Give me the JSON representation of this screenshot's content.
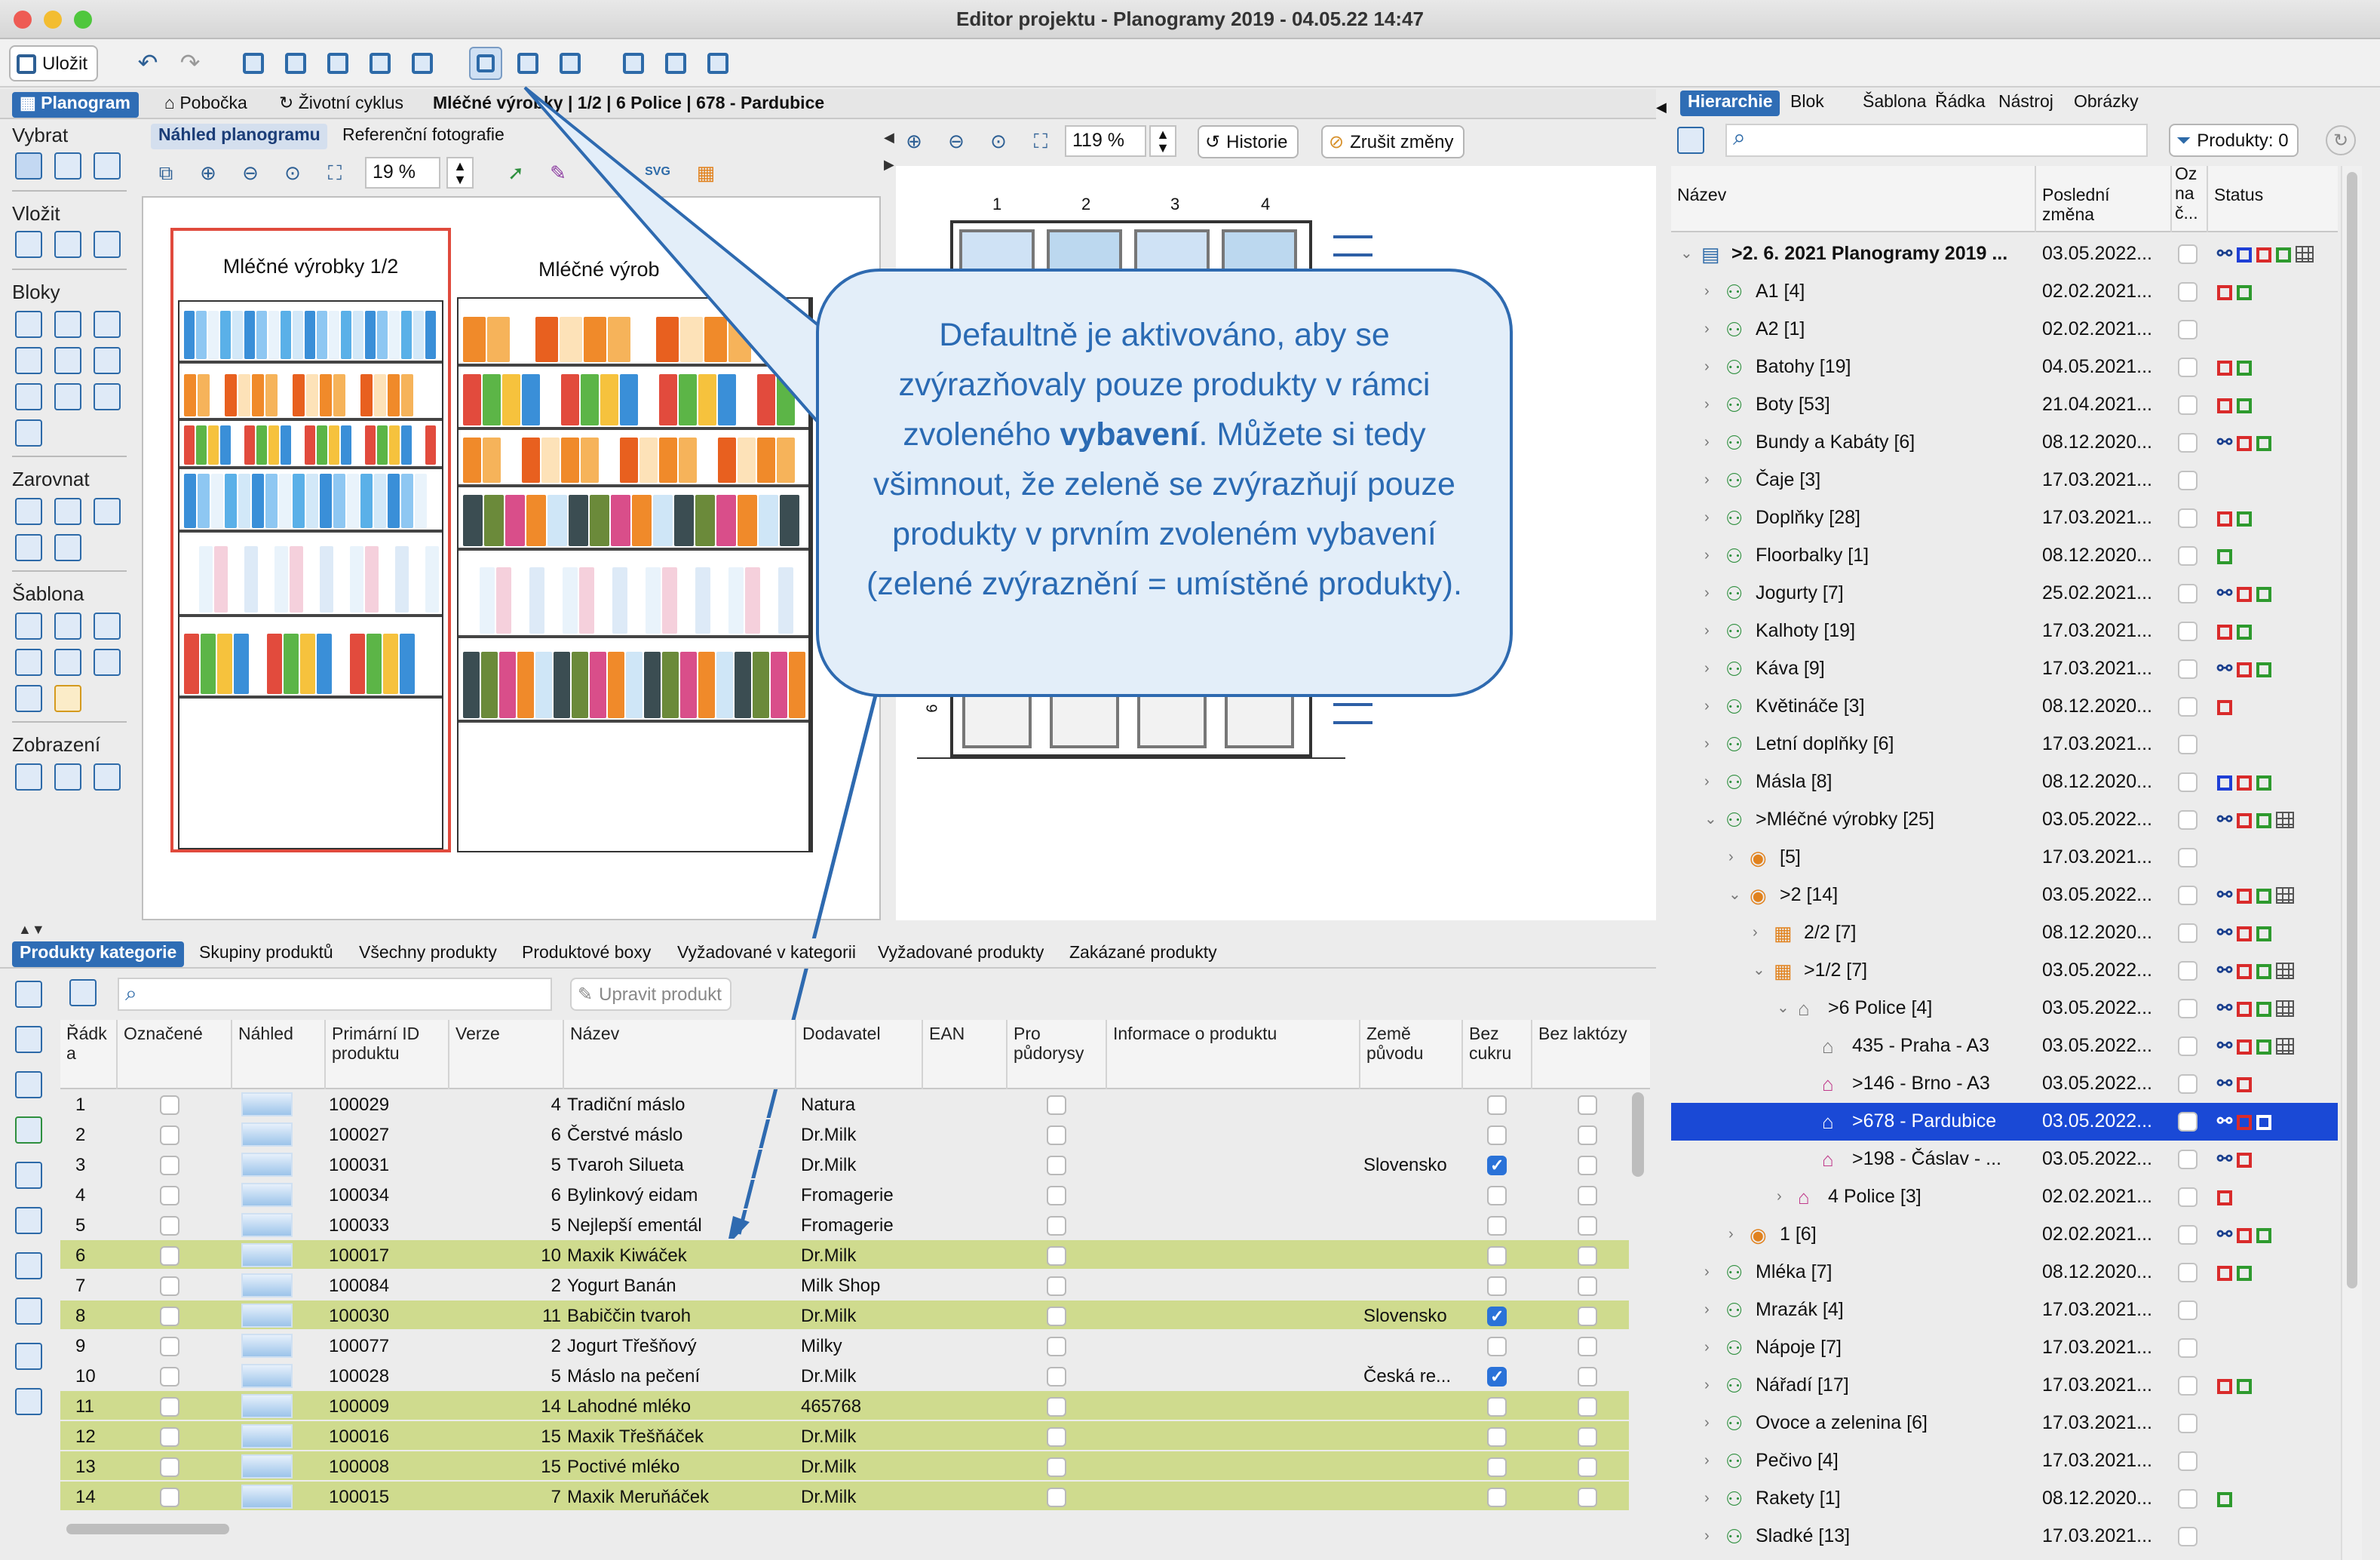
{
  "window": {
    "title": "Editor projektu - Planogramy 2019 - 04.05.22 14:47"
  },
  "toolbar": {
    "save": "Uložit"
  },
  "left_tabs": {
    "items": [
      "Planogram",
      "Pobočka",
      "Životní cyklus"
    ],
    "breadcrumb": "Mléčné výrobky | 1/2 | 6 Police | 678 - Pardubice"
  },
  "sidebar": {
    "sections": [
      "Vybrat",
      "Vložit",
      "Bloky",
      "Zarovnat",
      "Šablona",
      "Zobrazení"
    ]
  },
  "preview_tabs": [
    "Náhled planogramu",
    "Referenční fotografie"
  ],
  "preview": {
    "zoom": "19 %",
    "svg_label": "SVG",
    "title1": "Mléčné výrobky 1/2",
    "title2": "Mléčné výrob"
  },
  "detail": {
    "zoom": "119 %",
    "history": "Historie",
    "cancel": "Zrušit změny",
    "columns": [
      "1",
      "2",
      "3",
      "4"
    ],
    "shelf_num": "6"
  },
  "callout": {
    "part1": "Defaultně je aktivováno, aby se zvýrazňovaly pouze produkty v rámci zvoleného ",
    "bold": "vybavení",
    "part2": ". Můžete si tedy všimnout, že zeleně se zvýrazňují pouze produkty v prvním zvoleném vybavení (zelené zvýraznění = umístěné produkty)."
  },
  "product_tabs": [
    "Produkty kategorie",
    "Skupiny produktů",
    "Všechny produkty",
    "Produktové boxy",
    "Vyžadované v kategorii",
    "Vyžadované produkty",
    "Zakázané produkty"
  ],
  "product_toolbar": {
    "edit": "Upravit produkt"
  },
  "table": {
    "headers": [
      "Řádk a",
      "Označené",
      "Náhled",
      "Primární ID produktu",
      "Verze",
      "Název",
      "Dodavatel",
      "EAN",
      "Pro půdorysy",
      "Informace o produktu",
      "Země původu",
      "Bez cukru",
      "Bez laktózy"
    ],
    "rows": [
      {
        "n": "1",
        "id": "100029",
        "ver": "4",
        "name": "Tradiční máslo",
        "sup": "Natura",
        "origin": "",
        "sugar": false,
        "hl": false
      },
      {
        "n": "2",
        "id": "100027",
        "ver": "6",
        "name": "Čerstvé máslo",
        "sup": "Dr.Milk",
        "origin": "",
        "sugar": false,
        "hl": false
      },
      {
        "n": "3",
        "id": "100031",
        "ver": "5",
        "name": "Tvaroh Silueta",
        "sup": "Dr.Milk",
        "origin": "Slovensko",
        "sugar": true,
        "hl": false
      },
      {
        "n": "4",
        "id": "100034",
        "ver": "6",
        "name": "Bylinkový eidam",
        "sup": "Fromagerie",
        "origin": "",
        "sugar": false,
        "hl": false
      },
      {
        "n": "5",
        "id": "100033",
        "ver": "5",
        "name": "Nejlepší ementál",
        "sup": "Fromagerie",
        "origin": "",
        "sugar": false,
        "hl": false
      },
      {
        "n": "6",
        "id": "100017",
        "ver": "10",
        "name": "Maxik Kiwáček",
        "sup": "Dr.Milk",
        "origin": "",
        "sugar": false,
        "hl": true
      },
      {
        "n": "7",
        "id": "100084",
        "ver": "2",
        "name": "Yogurt Banán",
        "sup": "Milk Shop",
        "origin": "",
        "sugar": false,
        "hl": false
      },
      {
        "n": "8",
        "id": "100030",
        "ver": "11",
        "name": "Babiččin tvaroh",
        "sup": "Dr.Milk",
        "origin": "Slovensko",
        "sugar": true,
        "hl": true
      },
      {
        "n": "9",
        "id": "100077",
        "ver": "2",
        "name": "Jogurt Třešňový",
        "sup": "Milky",
        "origin": "",
        "sugar": false,
        "hl": false
      },
      {
        "n": "10",
        "id": "100028",
        "ver": "5",
        "name": "Máslo na pečení",
        "sup": "Dr.Milk",
        "origin": "Česká re...",
        "sugar": true,
        "hl": false
      },
      {
        "n": "11",
        "id": "100009",
        "ver": "14",
        "name": "Lahodné mléko",
        "sup": "465768",
        "origin": "",
        "sugar": false,
        "hl": true
      },
      {
        "n": "12",
        "id": "100016",
        "ver": "15",
        "name": "Maxik Třešňáček",
        "sup": "Dr.Milk",
        "origin": "",
        "sugar": false,
        "hl": true
      },
      {
        "n": "13",
        "id": "100008",
        "ver": "15",
        "name": "Poctivé mléko",
        "sup": "Dr.Milk",
        "origin": "",
        "sugar": false,
        "hl": true
      },
      {
        "n": "14",
        "id": "100015",
        "ver": "7",
        "name": "Maxik Meruňáček",
        "sup": "Dr.Milk",
        "origin": "",
        "sugar": false,
        "hl": true
      }
    ]
  },
  "right_tabs": [
    "Hierarchie",
    "Blok",
    "Šablona",
    "Řádka",
    "Nástroj",
    "Obrázky"
  ],
  "right_toolbar": {
    "products": "Produkty: 0"
  },
  "tree_headers": [
    "Název",
    "Poslední změna",
    "Oz na č...",
    "Status"
  ],
  "tree": [
    {
      "name": ">2. 6. 2021 Planogramy 2019 ...",
      "date": "03.05.2022...",
      "lvl": 0,
      "chev": "v",
      "ico": "root",
      "st": "n b r g grid",
      "bold": true
    },
    {
      "name": "A1 [4]",
      "date": "02.02.2021...",
      "lvl": 1,
      "chev": ">",
      "ico": "net",
      "st": "r g"
    },
    {
      "name": "A2 [1]",
      "date": "02.02.2021...",
      "lvl": 1,
      "chev": ">",
      "ico": "net",
      "st": ""
    },
    {
      "name": "Batohy [19]",
      "date": "04.05.2021...",
      "lvl": 1,
      "chev": ">",
      "ico": "net",
      "st": "r g"
    },
    {
      "name": "Boty [53]",
      "date": "21.04.2021...",
      "lvl": 1,
      "chev": ">",
      "ico": "net",
      "st": "r g"
    },
    {
      "name": "Bundy a Kabáty [6]",
      "date": "08.12.2020...",
      "lvl": 1,
      "chev": ">",
      "ico": "net",
      "st": "n r g"
    },
    {
      "name": "Čaje [3]",
      "date": "17.03.2021...",
      "lvl": 1,
      "chev": ">",
      "ico": "net",
      "st": ""
    },
    {
      "name": "Doplňky [28]",
      "date": "17.03.2021...",
      "lvl": 1,
      "chev": ">",
      "ico": "net",
      "st": "r g"
    },
    {
      "name": "Floorbalky [1]",
      "date": "08.12.2020...",
      "lvl": 1,
      "chev": ">",
      "ico": "net",
      "st": "g"
    },
    {
      "name": "Jogurty [7]",
      "date": "25.02.2021...",
      "lvl": 1,
      "chev": ">",
      "ico": "net",
      "st": "n r g"
    },
    {
      "name": "Kalhoty [19]",
      "date": "17.03.2021...",
      "lvl": 1,
      "chev": ">",
      "ico": "net",
      "st": "r g"
    },
    {
      "name": "Káva [9]",
      "date": "17.03.2021...",
      "lvl": 1,
      "chev": ">",
      "ico": "net",
      "st": "n r g"
    },
    {
      "name": "Květináče [3]",
      "date": "08.12.2020...",
      "lvl": 1,
      "chev": ">",
      "ico": "net",
      "st": "r"
    },
    {
      "name": "Letní doplňky [6]",
      "date": "17.03.2021...",
      "lvl": 1,
      "chev": ">",
      "ico": "net",
      "st": ""
    },
    {
      "name": "Másla [8]",
      "date": "08.12.2020...",
      "lvl": 1,
      "chev": ">",
      "ico": "net",
      "st": "b r g"
    },
    {
      "name": ">Mléčné výrobky [25]",
      "date": "03.05.2022...",
      "lvl": 1,
      "chev": "v",
      "ico": "net",
      "st": "n r g grid"
    },
    {
      "name": "[5]",
      "date": "17.03.2021...",
      "lvl": 2,
      "chev": ">",
      "ico": "orb",
      "st": ""
    },
    {
      "name": ">2 [14]",
      "date": "03.05.2022...",
      "lvl": 2,
      "chev": "v",
      "ico": "orb",
      "st": "n r g grid"
    },
    {
      "name": "2/2 [7]",
      "date": "08.12.2020...",
      "lvl": 3,
      "chev": ">",
      "ico": "shelf",
      "st": "n r g"
    },
    {
      "name": ">1/2 [7]",
      "date": "03.05.2022...",
      "lvl": 3,
      "chev": "v",
      "ico": "shelf",
      "st": "n r g grid"
    },
    {
      "name": ">6 Police [4]",
      "date": "03.05.2022...",
      "lvl": 4,
      "chev": "v",
      "ico": "store",
      "st": "n r g grid"
    },
    {
      "name": "435 - Praha - A3",
      "date": "03.05.2022...",
      "lvl": 5,
      "chev": "",
      "ico": "store",
      "st": "n r g grid"
    },
    {
      "name": ">146 - Brno - A3",
      "date": "03.05.2022...",
      "lvl": 5,
      "chev": "",
      "ico": "storep",
      "st": "n r"
    },
    {
      "name": ">678 - Pardubice",
      "date": "03.05.2022...",
      "lvl": 5,
      "chev": "",
      "ico": "storep",
      "st": "n r g",
      "sel": true
    },
    {
      "name": ">198 - Čáslav - ...",
      "date": "03.05.2022...",
      "lvl": 5,
      "chev": "",
      "ico": "storep",
      "st": "n r"
    },
    {
      "name": "4 Police [3]",
      "date": "02.02.2021...",
      "lvl": 4,
      "chev": ">",
      "ico": "storep",
      "st": "r"
    },
    {
      "name": "1 [6]",
      "date": "02.02.2021...",
      "lvl": 2,
      "chev": ">",
      "ico": "orb",
      "st": "n r g"
    },
    {
      "name": "Mléka [7]",
      "date": "08.12.2020...",
      "lvl": 1,
      "chev": ">",
      "ico": "net",
      "st": "r g"
    },
    {
      "name": "Mrazák [4]",
      "date": "17.03.2021...",
      "lvl": 1,
      "chev": ">",
      "ico": "net",
      "st": ""
    },
    {
      "name": "Nápoje [7]",
      "date": "17.03.2021...",
      "lvl": 1,
      "chev": ">",
      "ico": "net",
      "st": ""
    },
    {
      "name": "Nářadí [17]",
      "date": "17.03.2021...",
      "lvl": 1,
      "chev": ">",
      "ico": "net",
      "st": "r g"
    },
    {
      "name": "Ovoce a zelenina [6]",
      "date": "17.03.2021...",
      "lvl": 1,
      "chev": ">",
      "ico": "net",
      "st": ""
    },
    {
      "name": "Pečivo [4]",
      "date": "17.03.2021...",
      "lvl": 1,
      "chev": ">",
      "ico": "net",
      "st": ""
    },
    {
      "name": "Rakety [1]",
      "date": "08.12.2020...",
      "lvl": 1,
      "chev": ">",
      "ico": "net",
      "st": "g"
    },
    {
      "name": "Sladké [13]",
      "date": "17.03.2021...",
      "lvl": 1,
      "chev": ">",
      "ico": "net",
      "st": ""
    }
  ],
  "colors": {
    "accent": "#2f6db5",
    "highlight": "#cfdb8e",
    "selected": "#1a49d6",
    "callout": "#2e6ab0"
  }
}
